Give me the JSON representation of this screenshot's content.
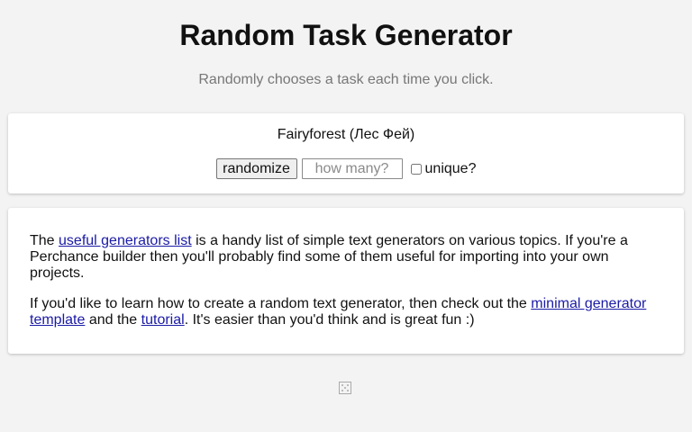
{
  "header": {
    "title": "Random Task Generator",
    "subtitle": "Randomly chooses a task each time you click."
  },
  "generator": {
    "result": "Fairyforest (Лес Фей)",
    "randomize_label": "randomize",
    "count_placeholder": "how many?",
    "unique_label": "unique?",
    "unique_checked": false
  },
  "info": {
    "p1_before": "The ",
    "p1_link": "useful generators list",
    "p1_after": " is a handy list of simple text generators on various topics. If you're a Perchance builder then you'll probably find some of them useful for importing into your own projects.",
    "p2_before": "If you'd like to learn how to create a random text generator, then check out the ",
    "p2_link1": "minimal generator template",
    "p2_mid": " and the ",
    "p2_link2": "tutorial",
    "p2_after": ". It's easier than you'd think and is great fun :)"
  },
  "footer": {
    "icon": "dice-icon"
  },
  "colors": {
    "background": "#f3f3f3",
    "link": "#1a1aa6",
    "subtitle": "#777777"
  }
}
